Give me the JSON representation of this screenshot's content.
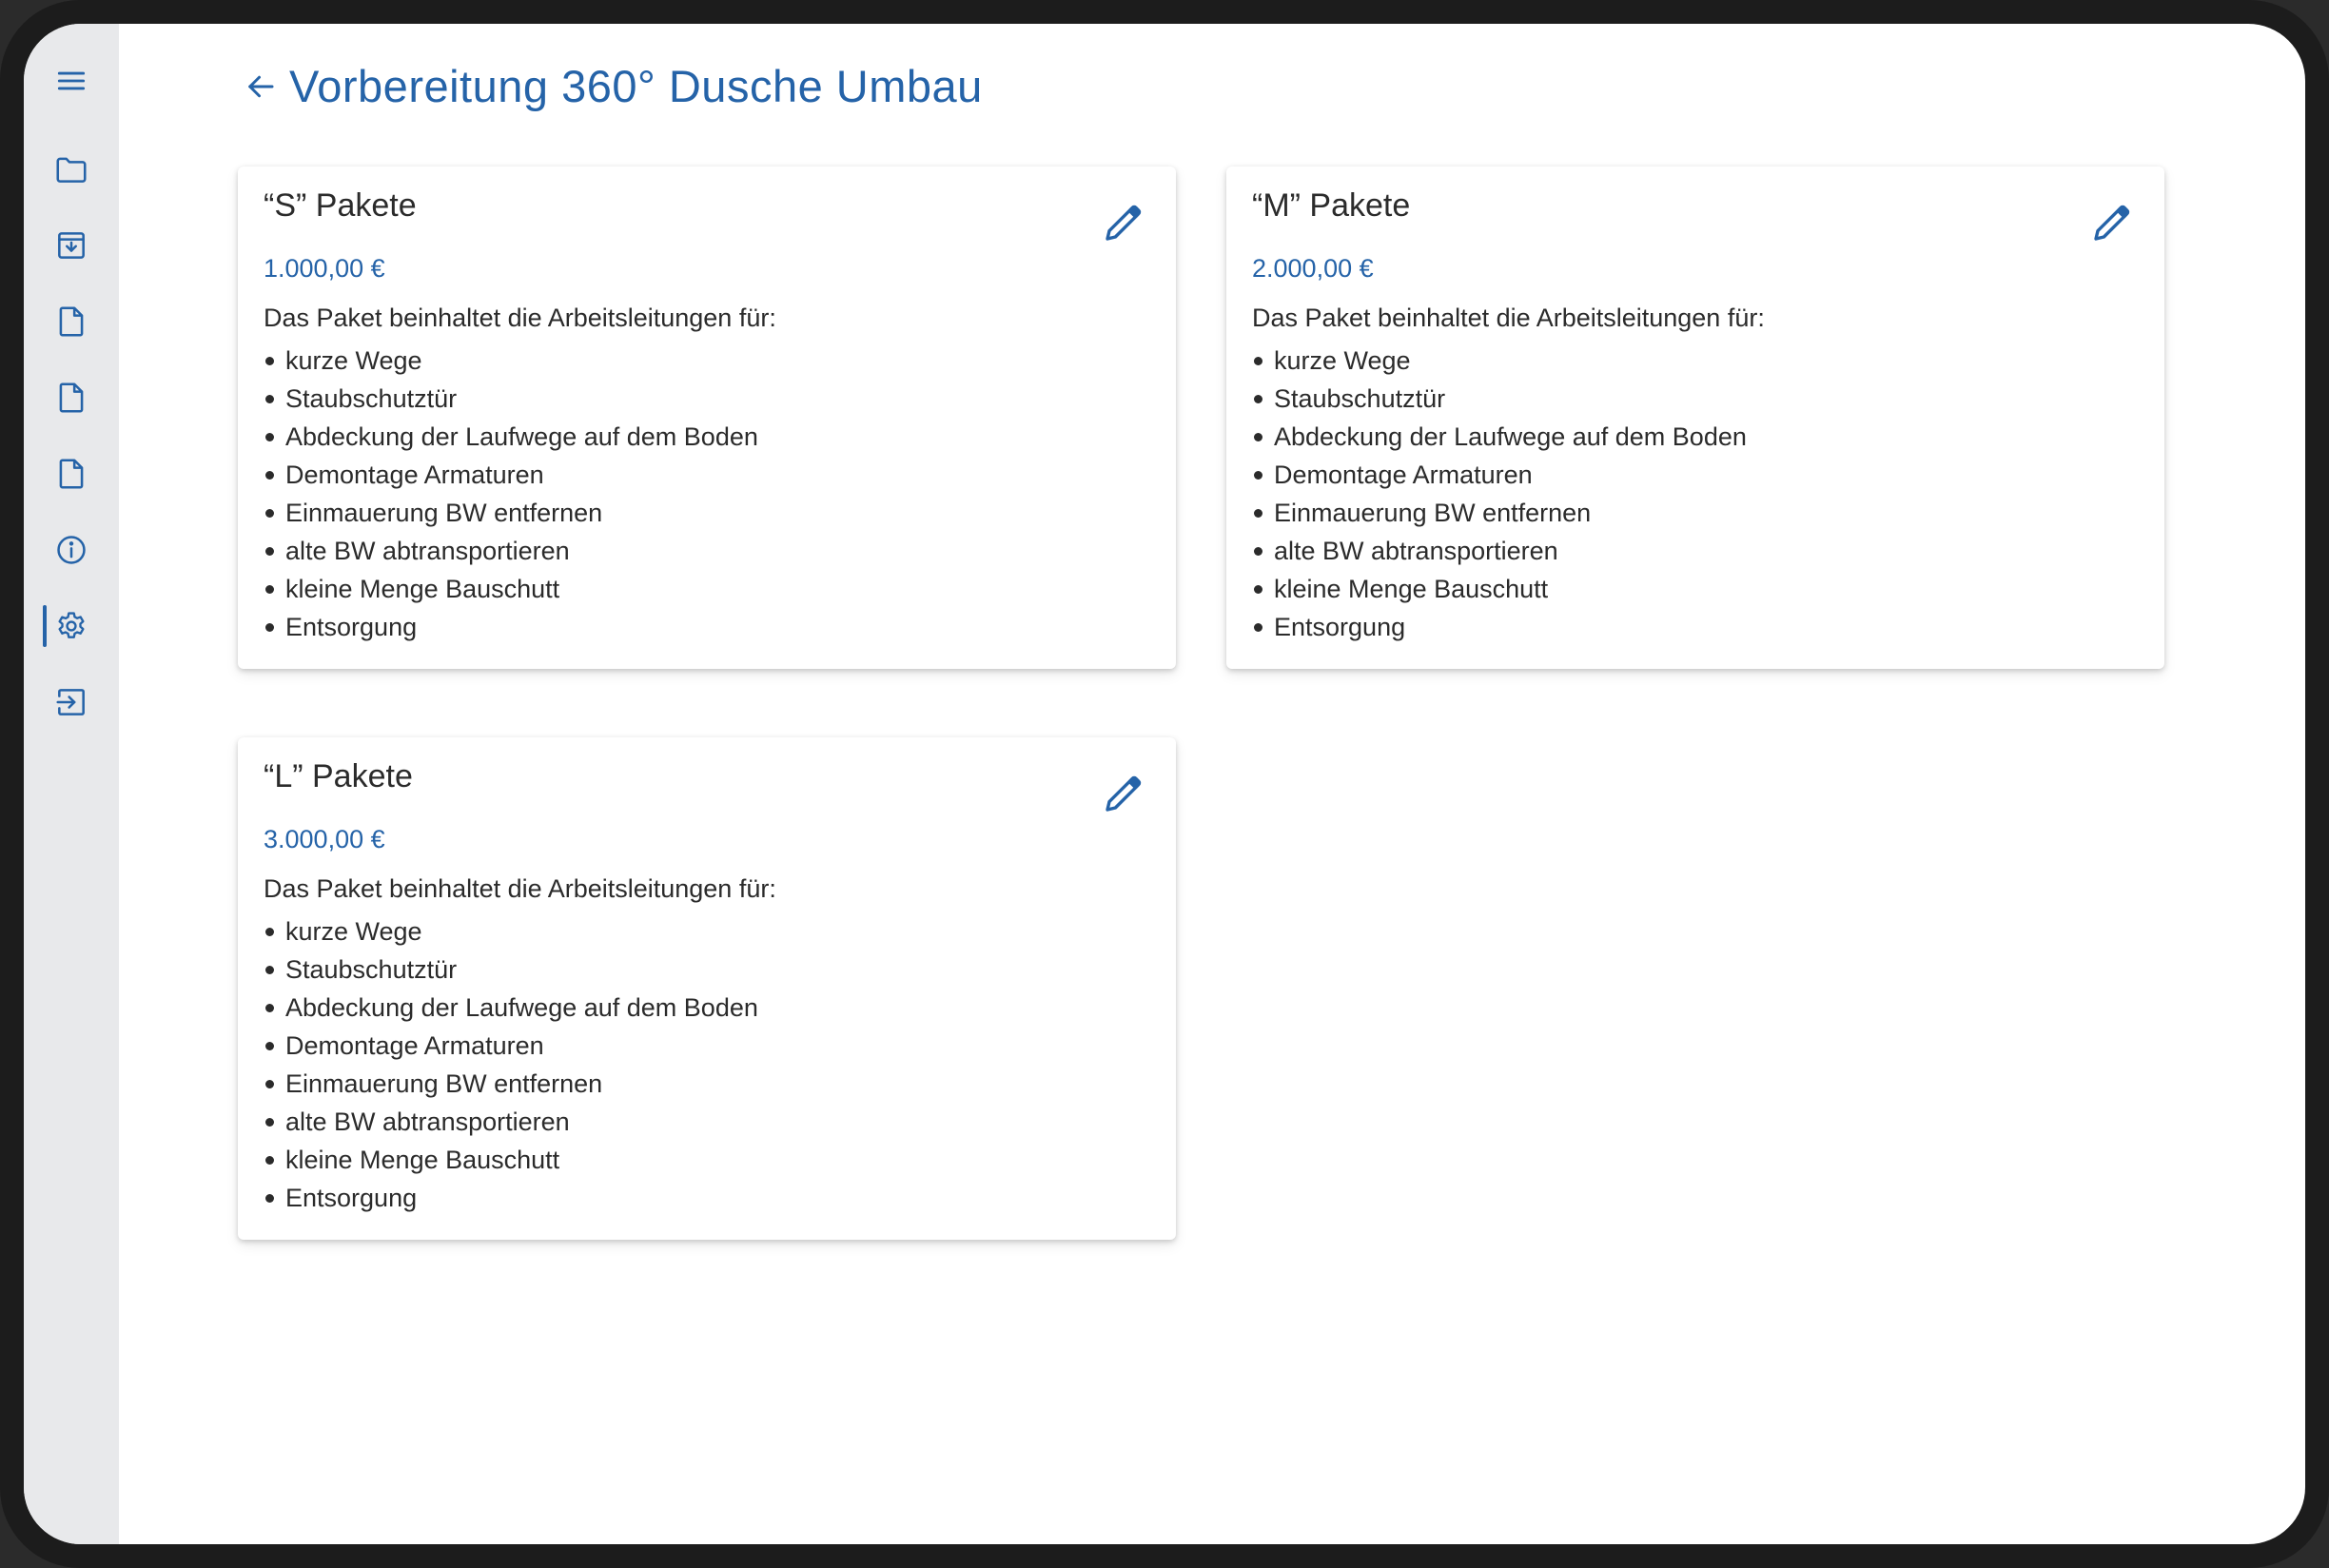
{
  "header": {
    "title": "Vorbereitung 360° Dusche Umbau"
  },
  "sidebar": {
    "items": [
      {
        "icon": "menu-icon"
      },
      {
        "icon": "folder-icon"
      },
      {
        "icon": "archive-icon"
      },
      {
        "icon": "document-icon"
      },
      {
        "icon": "document-icon"
      },
      {
        "icon": "document-icon"
      },
      {
        "icon": "info-icon"
      },
      {
        "icon": "settings-icon",
        "active": true
      },
      {
        "icon": "logout-icon"
      }
    ]
  },
  "colors": {
    "accent": "#2563a8",
    "sidebar_bg": "#e8e9eb",
    "text": "#2b2b2b"
  },
  "cards": [
    {
      "title": "“S” Pakete",
      "price": "1.000,00 €",
      "description": "Das Paket beinhaltet die Arbeitsleitungen für:",
      "items": [
        "kurze Wege",
        "Staubschutztür",
        "Abdeckung der Laufwege auf dem Boden",
        "Demontage Armaturen",
        "Einmauerung BW entfernen",
        "alte BW abtransportieren",
        "kleine Menge Bauschutt",
        "Entsorgung"
      ]
    },
    {
      "title": "“M” Pakete",
      "price": "2.000,00 €",
      "description": "Das Paket beinhaltet die Arbeitsleitungen für:",
      "items": [
        "kurze Wege",
        "Staubschutztür",
        "Abdeckung der Laufwege auf dem Boden",
        "Demontage Armaturen",
        "Einmauerung BW entfernen",
        "alte BW abtransportieren",
        "kleine Menge Bauschutt",
        "Entsorgung"
      ]
    },
    {
      "title": "“L” Pakete",
      "price": "3.000,00 €",
      "description": "Das Paket beinhaltet die Arbeitsleitungen für:",
      "items": [
        "kurze Wege",
        "Staubschutztür",
        "Abdeckung der Laufwege auf dem Boden",
        "Demontage Armaturen",
        "Einmauerung BW entfernen",
        "alte BW abtransportieren",
        "kleine Menge Bauschutt",
        "Entsorgung"
      ]
    }
  ]
}
